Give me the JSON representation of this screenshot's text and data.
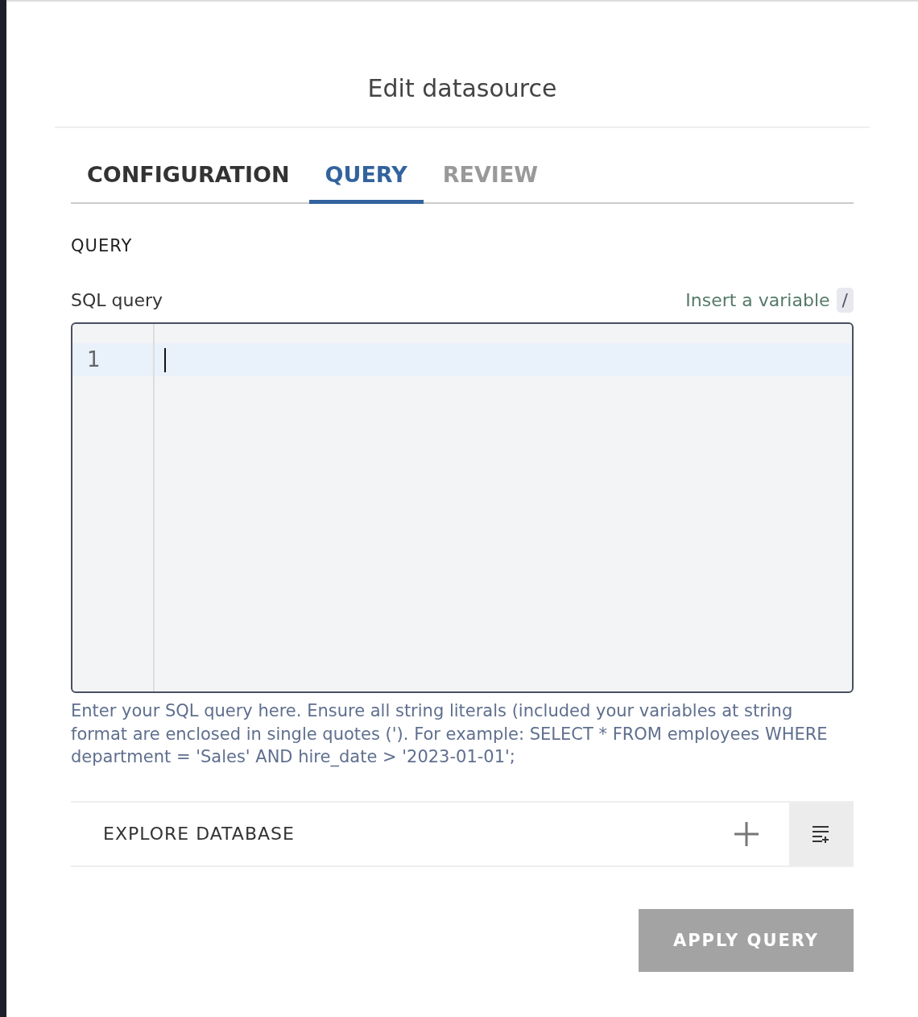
{
  "dialog": {
    "title": "Edit datasource"
  },
  "tabs": [
    {
      "label": "CONFIGURATION",
      "selected": false,
      "disabled": false
    },
    {
      "label": "QUERY",
      "selected": true,
      "disabled": false
    },
    {
      "label": "REVIEW",
      "selected": false,
      "disabled": true
    }
  ],
  "section_title": "QUERY",
  "sql_field": {
    "label": "SQL query",
    "insert_variable": "Insert a variable",
    "shortcut": "/",
    "line_numbers": [
      "1"
    ],
    "help": "Enter your SQL query here. Ensure all string literals (included your variables at string format are enclosed in single quotes ('). For example: SELECT * FROM employees WHERE department = 'Sales' AND hire_date > '2023-01-01';"
  },
  "explore": {
    "label": "EXPLORE DATABASE",
    "expanded": false
  },
  "apply_button": {
    "label": "APPLY QUERY",
    "disabled": true
  }
}
